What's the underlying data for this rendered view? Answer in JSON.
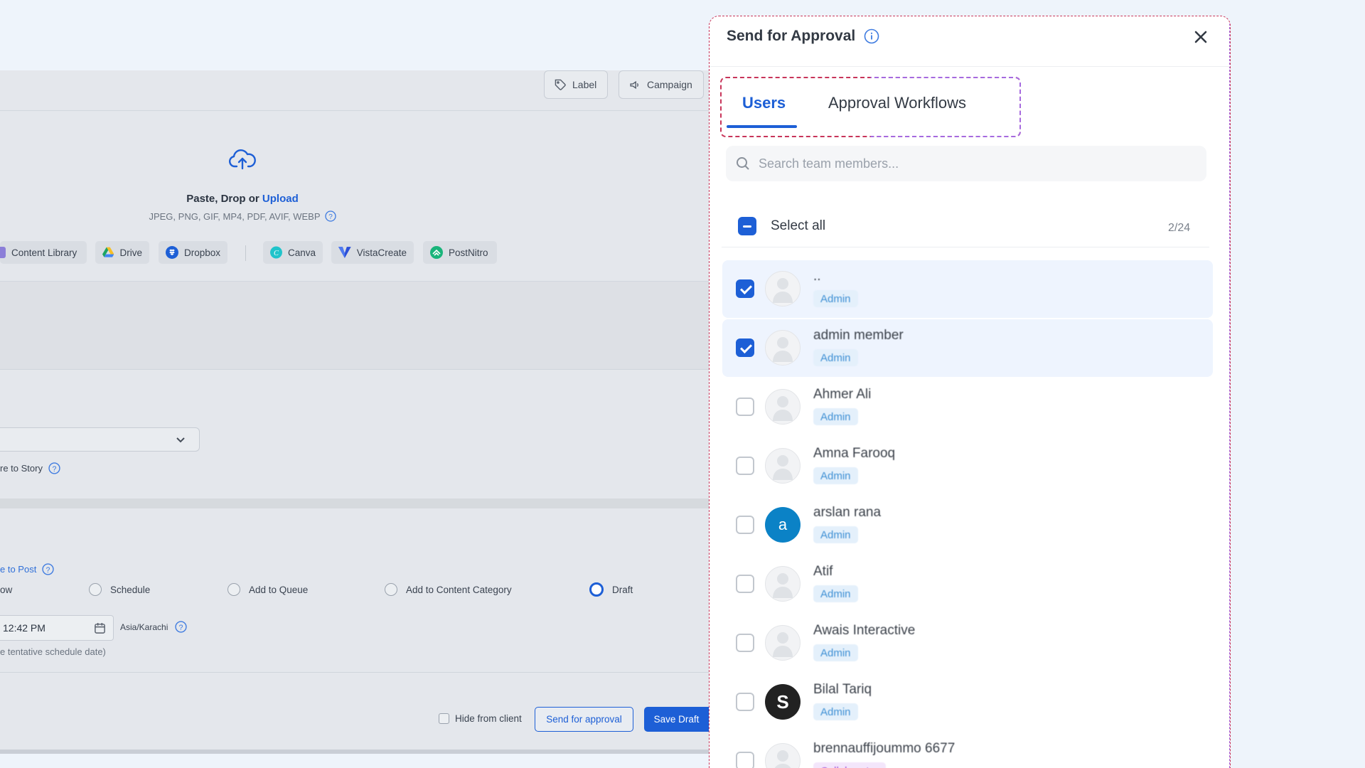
{
  "toolbar": {
    "label": "Label",
    "campaign": "Campaign"
  },
  "upload": {
    "text_prefix": "Paste, Drop or",
    "upload_link": "Upload",
    "formats": "JPEG, PNG, GIF, MP4, PDF, AVIF, WEBP",
    "sources": [
      "Content Library",
      "Drive",
      "Dropbox",
      "Canva",
      "VistaCreate",
      "PostNitro"
    ]
  },
  "story_option": "re to Story",
  "post_link": "e to Post",
  "posting": {
    "options": [
      "ow",
      "Schedule",
      "Add to Queue",
      "Add to Content Category",
      "Draft"
    ],
    "selected": "Draft",
    "time": "12:42 PM",
    "timezone": "Asia/Karachi",
    "tentative_note": "e tentative schedule date)"
  },
  "footer": {
    "hide_from_client": "Hide from client",
    "send_for_approval": "Send for approval",
    "save_draft": "Save Draft"
  },
  "panel": {
    "title": "Send for Approval",
    "tabs": [
      "Users",
      "Approval Workflows"
    ],
    "active_tab": "Users",
    "search_placeholder": "Search team members...",
    "select_all": "Select all",
    "count": "2/24",
    "users": [
      {
        "name": "..",
        "role": "Admin",
        "checked": true,
        "avatar": "placeholder"
      },
      {
        "name": "admin member",
        "role": "Admin",
        "checked": true,
        "avatar": "placeholder"
      },
      {
        "name": "Ahmer Ali",
        "role": "Admin",
        "checked": false,
        "avatar": "placeholder"
      },
      {
        "name": "Amna Farooq",
        "role": "Admin",
        "checked": false,
        "avatar": "placeholder"
      },
      {
        "name": "arslan rana",
        "role": "Admin",
        "checked": false,
        "avatar": "letter",
        "letter": "a"
      },
      {
        "name": "Atif",
        "role": "Admin",
        "checked": false,
        "avatar": "placeholder"
      },
      {
        "name": "Awais Interactive",
        "role": "Admin",
        "checked": false,
        "avatar": "placeholder"
      },
      {
        "name": "Bilal Tariq",
        "role": "Admin",
        "checked": false,
        "avatar": "letter-dark",
        "letter": "S"
      },
      {
        "name": "brennauffijoummo 6677",
        "role": "Collaborator",
        "checked": false,
        "avatar": "placeholder"
      }
    ]
  },
  "colors": {
    "accent": "#1d5fd6",
    "role_admin": "#3d8fd4",
    "role_collaborator": "#a14bd6",
    "highlight_dash": "#c8355a"
  }
}
